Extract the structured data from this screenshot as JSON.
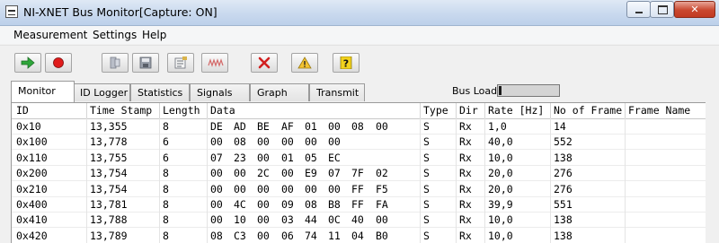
{
  "window": {
    "title": "NI-XNET Bus Monitor[Capture: ON]",
    "close_label": "✕"
  },
  "menu": {
    "items": [
      "Measurement",
      "Settings",
      "Help"
    ]
  },
  "toolbar": {
    "buttons": [
      {
        "name": "start-arrow-icon",
        "color": "#2fa63a"
      },
      {
        "name": "stop-icon",
        "color": "#e01b1b"
      },
      {
        "name": "filter-icon",
        "color": "#8a8f9a"
      },
      {
        "name": "save-icon",
        "color": "#6a6f78"
      },
      {
        "name": "properties-icon",
        "color": "#6a6f78"
      },
      {
        "name": "signal-wave-icon",
        "color": "#d46a6a"
      },
      {
        "name": "clear-x-icon",
        "color": "#d11f1f"
      },
      {
        "name": "warning-icon",
        "color": "#f2c230"
      },
      {
        "name": "help-icon",
        "color": "#f2d21d"
      }
    ]
  },
  "tabs": [
    {
      "label": "Monitor",
      "active": true
    },
    {
      "label": "ID Logger",
      "active": false
    },
    {
      "label": "Statistics",
      "active": false
    },
    {
      "label": "Signals",
      "active": false
    },
    {
      "label": "Graph",
      "active": false
    },
    {
      "label": "Transmit",
      "active": false
    }
  ],
  "bus_load": {
    "label": "Bus Load:",
    "fraction": 0.04
  },
  "table": {
    "columns": [
      "ID",
      "Time Stamp",
      "Length",
      "Data",
      "Type",
      "Dir",
      "Rate [Hz]",
      "No of Frame",
      "Frame Name"
    ],
    "rows": [
      {
        "id": "0x10",
        "time": "13,355",
        "length": "8",
        "data": [
          "DE",
          "AD",
          "BE",
          "AF",
          "01",
          "00",
          "08",
          "00"
        ],
        "type": "S",
        "dir": "Rx",
        "rate": "1,0",
        "frames": "14",
        "name": ""
      },
      {
        "id": "0x100",
        "time": "13,778",
        "length": "6",
        "data": [
          "00",
          "08",
          "00",
          "00",
          "00",
          "00"
        ],
        "type": "S",
        "dir": "Rx",
        "rate": "40,0",
        "frames": "552",
        "name": ""
      },
      {
        "id": "0x110",
        "time": "13,755",
        "length": "6",
        "data": [
          "07",
          "23",
          "00",
          "01",
          "05",
          "EC"
        ],
        "type": "S",
        "dir": "Rx",
        "rate": "10,0",
        "frames": "138",
        "name": ""
      },
      {
        "id": "0x200",
        "time": "13,754",
        "length": "8",
        "data": [
          "00",
          "00",
          "2C",
          "00",
          "E9",
          "07",
          "7F",
          "02"
        ],
        "type": "S",
        "dir": "Rx",
        "rate": "20,0",
        "frames": "276",
        "name": ""
      },
      {
        "id": "0x210",
        "time": "13,754",
        "length": "8",
        "data": [
          "00",
          "00",
          "00",
          "00",
          "00",
          "00",
          "FF",
          "F5"
        ],
        "type": "S",
        "dir": "Rx",
        "rate": "20,0",
        "frames": "276",
        "name": ""
      },
      {
        "id": "0x400",
        "time": "13,781",
        "length": "8",
        "data": [
          "00",
          "4C",
          "00",
          "09",
          "08",
          "B8",
          "FF",
          "FA"
        ],
        "type": "S",
        "dir": "Rx",
        "rate": "39,9",
        "frames": "551",
        "name": ""
      },
      {
        "id": "0x410",
        "time": "13,788",
        "length": "8",
        "data": [
          "00",
          "10",
          "00",
          "03",
          "44",
          "0C",
          "40",
          "00"
        ],
        "type": "S",
        "dir": "Rx",
        "rate": "10,0",
        "frames": "138",
        "name": ""
      },
      {
        "id": "0x420",
        "time": "13,789",
        "length": "8",
        "data": [
          "08",
          "C3",
          "00",
          "06",
          "74",
          "11",
          "04",
          "B0"
        ],
        "type": "S",
        "dir": "Rx",
        "rate": "10,0",
        "frames": "138",
        "name": ""
      }
    ]
  }
}
